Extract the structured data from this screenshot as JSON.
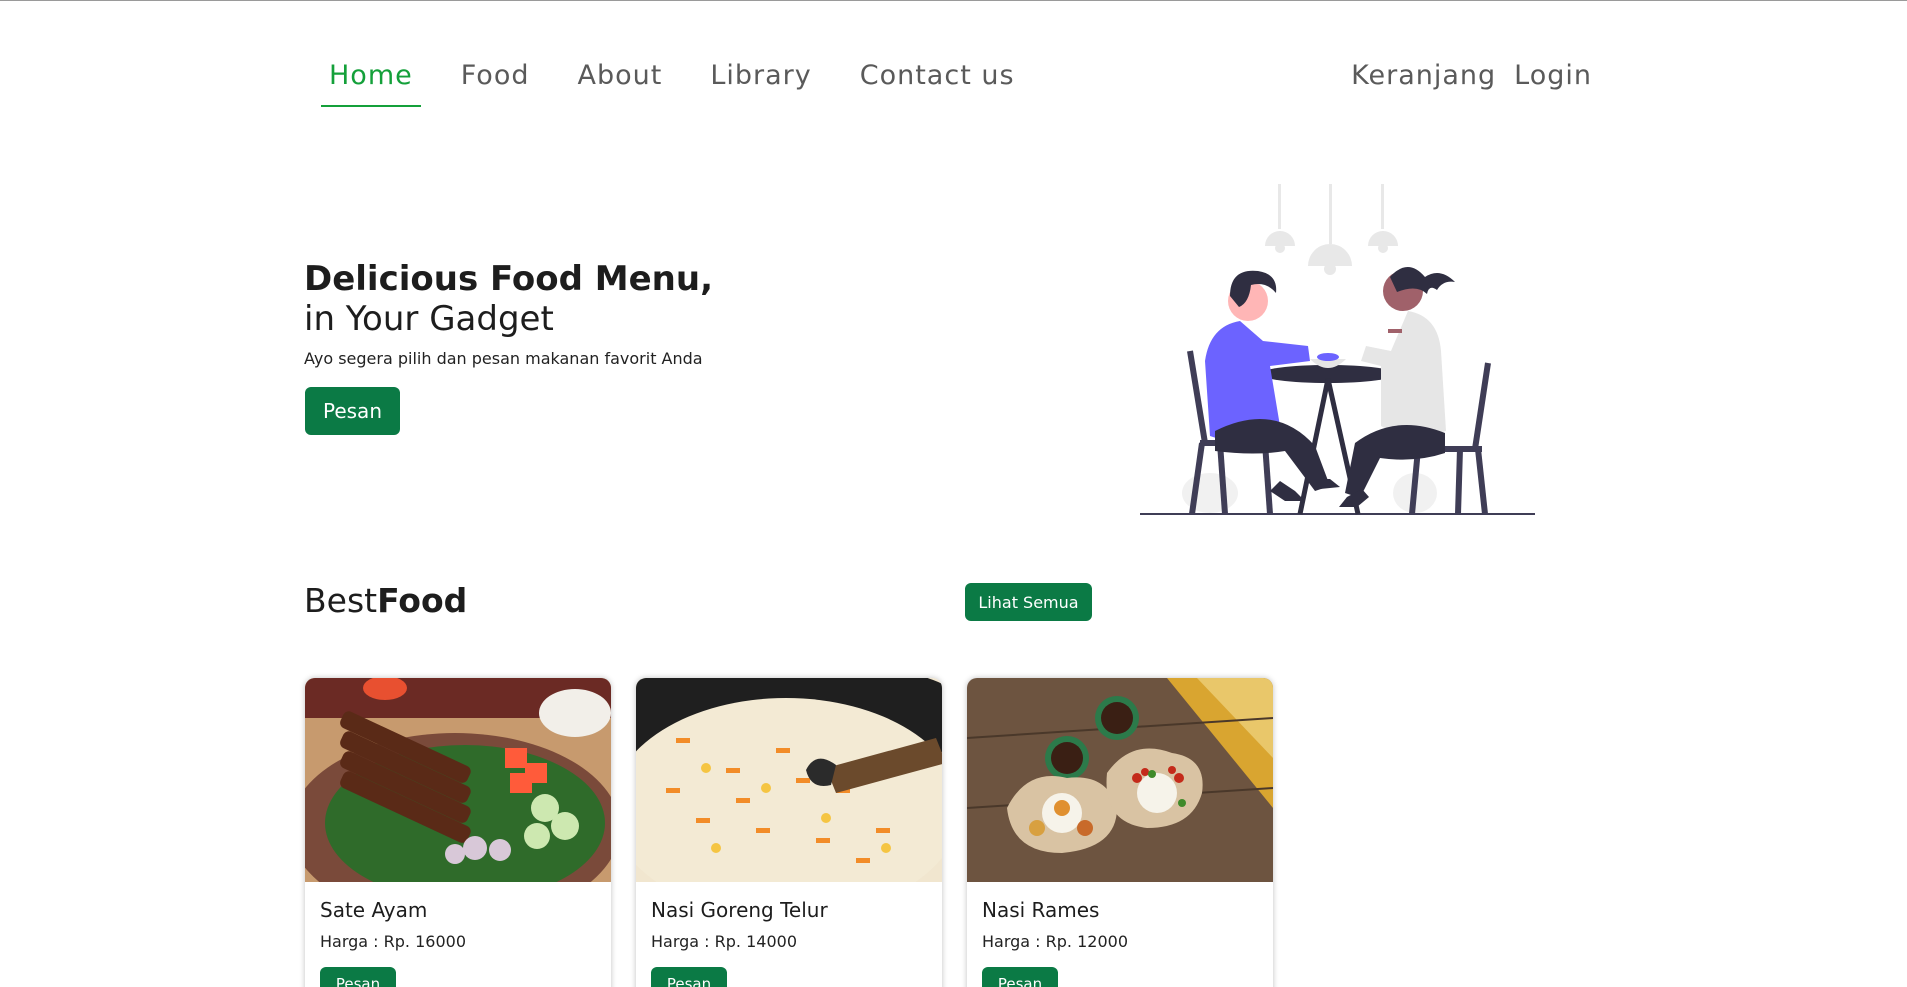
{
  "nav": {
    "items": [
      {
        "label": "Home",
        "active": true
      },
      {
        "label": "Food"
      },
      {
        "label": "About"
      },
      {
        "label": "Library"
      },
      {
        "label": "Contact us"
      }
    ],
    "right": [
      {
        "label": "Keranjang"
      },
      {
        "label": "Login"
      }
    ]
  },
  "hero": {
    "title": "Delicious Food Menu,",
    "subtitle": "in Your Gadget",
    "description": "Ayo segera pilih dan pesan makanan favorit Anda",
    "button": "Pesan"
  },
  "best_food": {
    "title_light": "Best",
    "title_bold": "Food",
    "see_all": "Lihat Semua",
    "items": [
      {
        "name": "Sate Ayam",
        "price": "Harga : Rp. 16000",
        "button": "Pesan"
      },
      {
        "name": "Nasi Goreng Telur",
        "price": "Harga : Rp. 14000",
        "button": "Pesan"
      },
      {
        "name": "Nasi Rames",
        "price": "Harga : Rp. 12000",
        "button": "Pesan"
      }
    ]
  },
  "colors": {
    "accent": "#14a03a",
    "button": "#0b7a45",
    "illustration_purple": "#6c63ff"
  }
}
